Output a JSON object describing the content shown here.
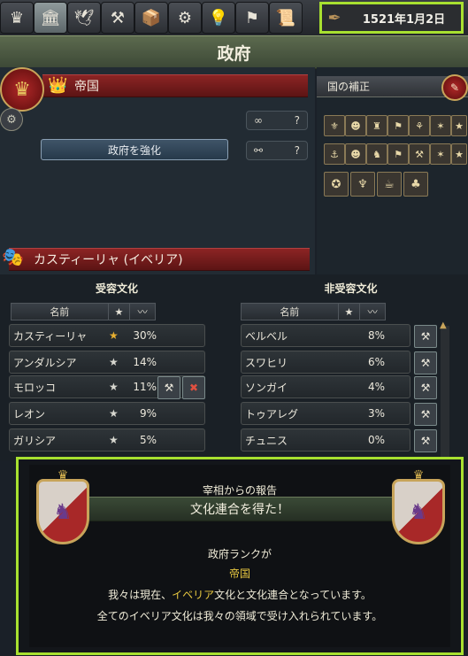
{
  "date": "1521年1月2日",
  "title": "政府",
  "government": {
    "rank": "帝国",
    "reform_button": "政府を強化",
    "box1_value": "?",
    "box2_value": "?",
    "culture": "カスティーリャ (イベリア)"
  },
  "modifiers": {
    "label": "国の補正"
  },
  "accepted": {
    "heading": "受容文化",
    "col_name": "名前",
    "rows": [
      {
        "name": "カスティーリャ",
        "pct": "30%"
      },
      {
        "name": "アンダルシア",
        "pct": "14%"
      },
      {
        "name": "モロッコ",
        "pct": "11%"
      },
      {
        "name": "レオン",
        "pct": "9%"
      },
      {
        "name": "ガリシア",
        "pct": "5%"
      }
    ]
  },
  "non_accepted": {
    "heading": "非受容文化",
    "col_name": "名前",
    "rows": [
      {
        "name": "ベルベル",
        "pct": "8%"
      },
      {
        "name": "スワヒリ",
        "pct": "6%"
      },
      {
        "name": "ソンガイ",
        "pct": "4%"
      },
      {
        "name": "トゥアレグ",
        "pct": "3%"
      },
      {
        "name": "チュニス",
        "pct": "0%"
      }
    ]
  },
  "popup": {
    "subtitle": "宰相からの報告",
    "title": "文化連合を得た！",
    "line1": "政府ランクが",
    "line2": "帝国",
    "line3a": "我々は現在、",
    "line3b": "イベリア",
    "line3c": "文化と文化連合となっています。",
    "line4": "全てのイベリア文化は我々の領域で受け入れられています。"
  }
}
